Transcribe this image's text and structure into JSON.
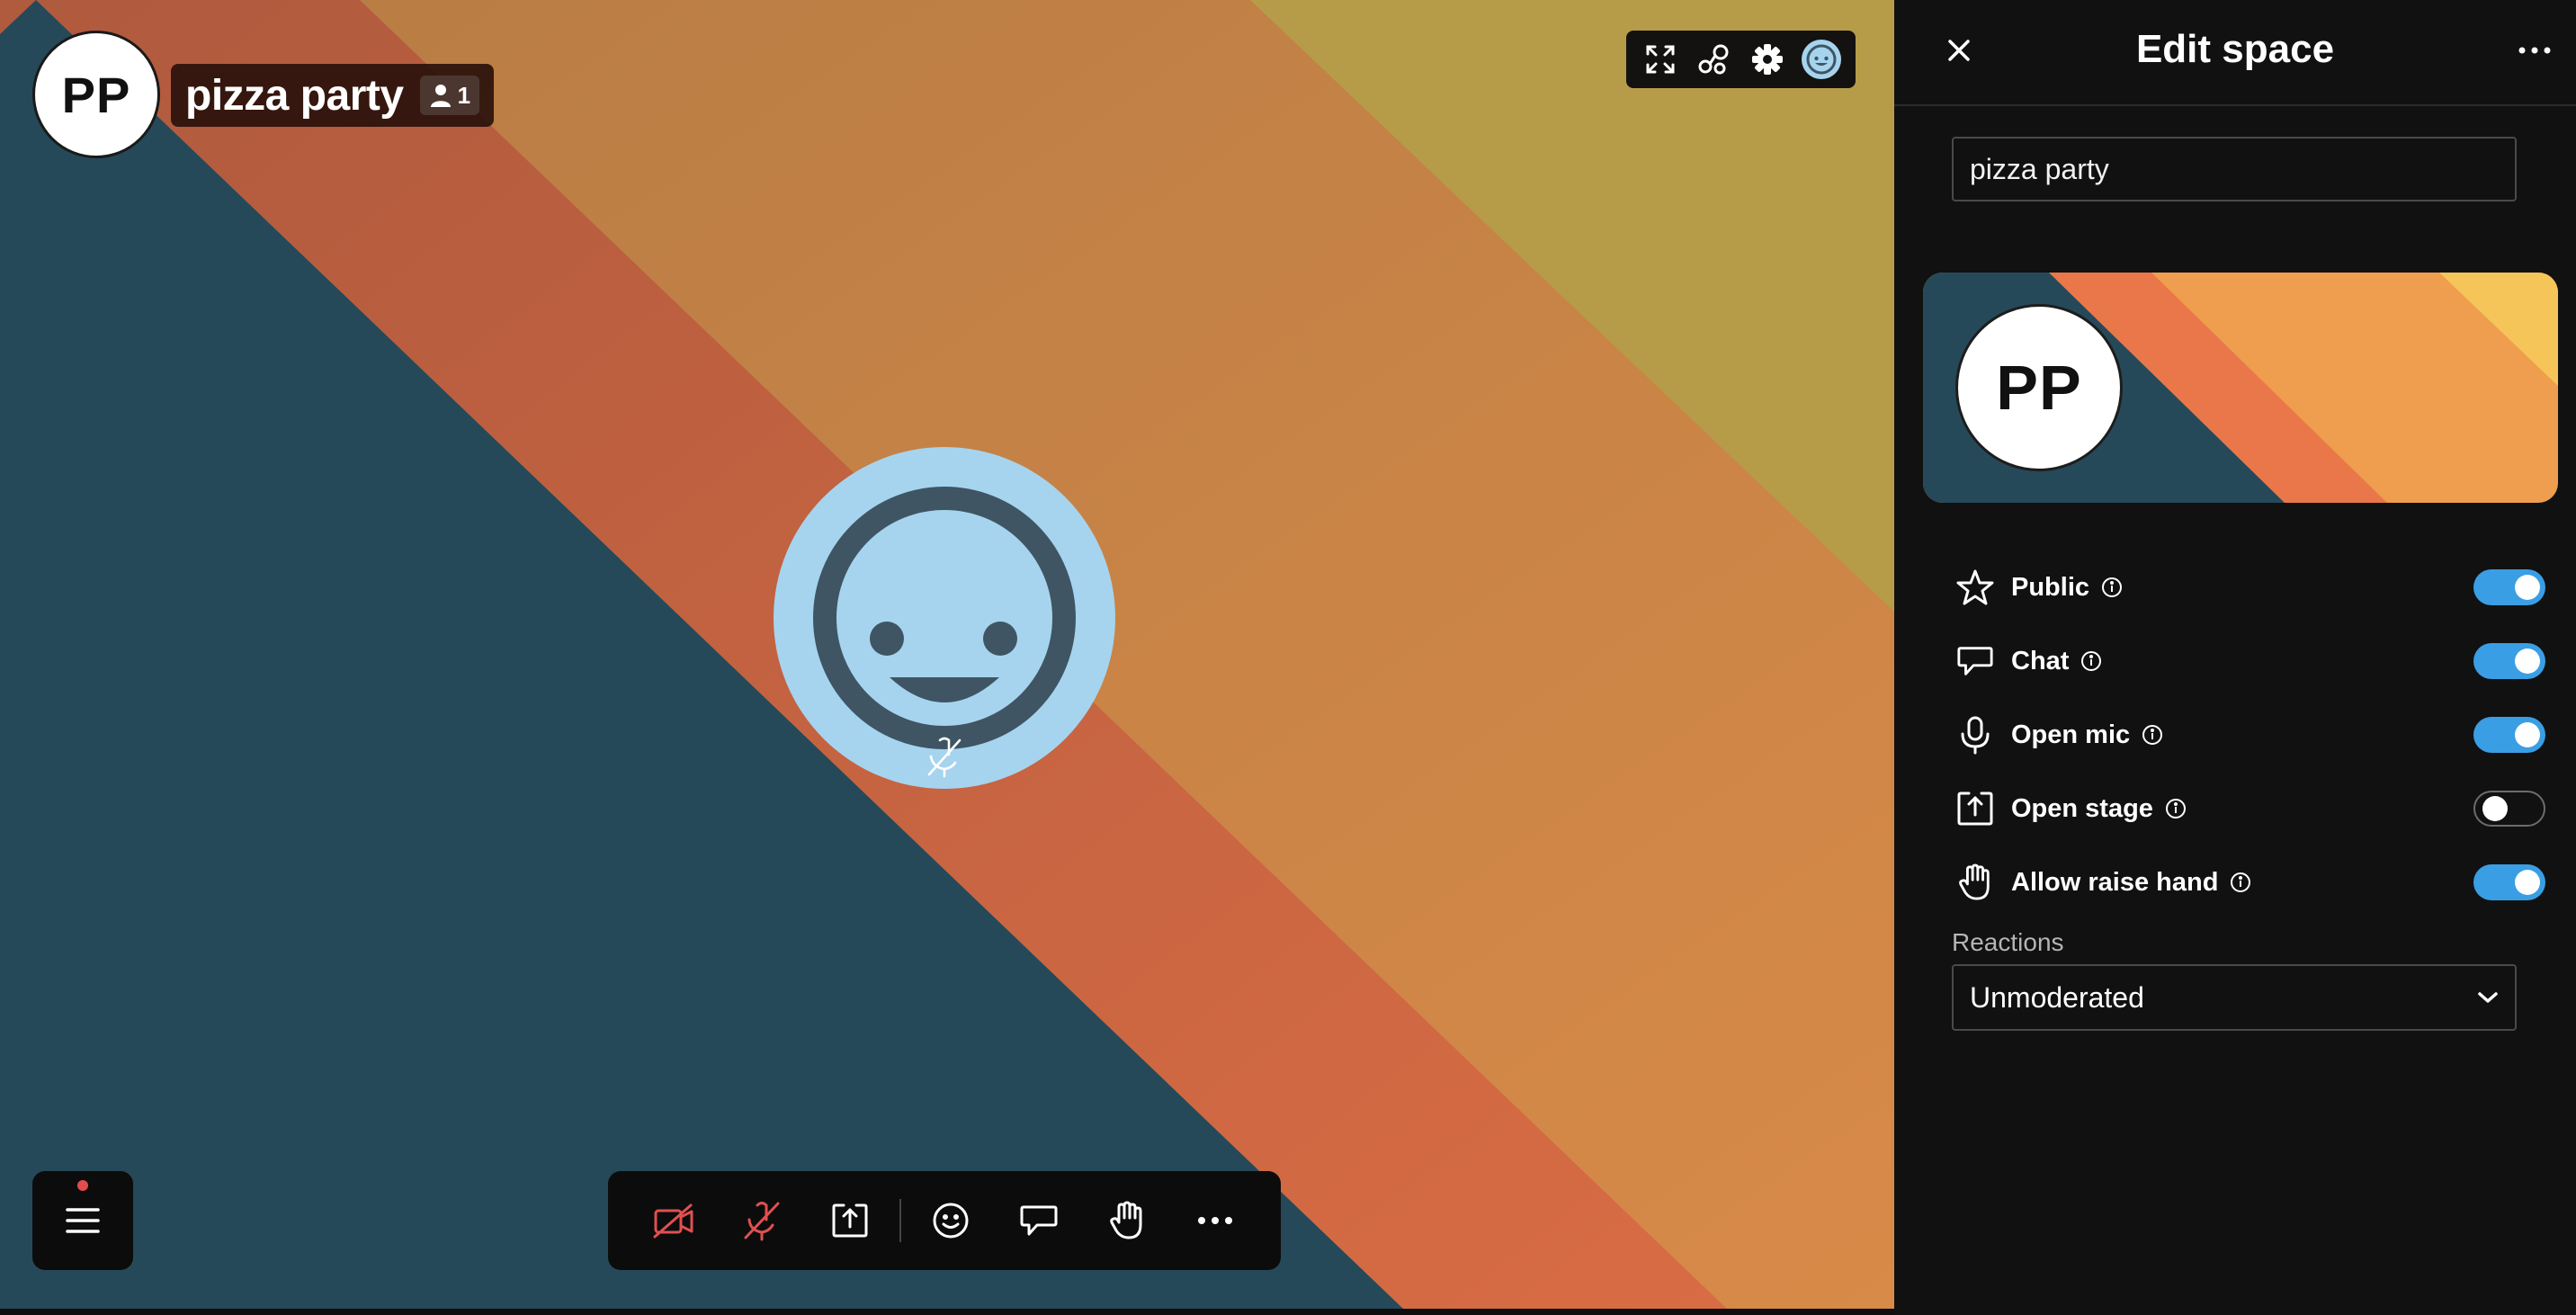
{
  "space": {
    "initials": "PP",
    "name": "pizza party",
    "participant_count": "1"
  },
  "toolbar_top": {
    "icons": [
      "fullscreen-icon",
      "share-network-icon",
      "gear-icon",
      "user-avatar-icon"
    ]
  },
  "toolbar_bottom": {
    "icons": [
      "camera-off-icon",
      "mic-off-icon",
      "share-screen-icon",
      "emoji-icon",
      "chat-icon",
      "raise-hand-icon",
      "more-icon"
    ]
  },
  "panel": {
    "title": "Edit space",
    "name_value": "pizza party",
    "banner_initials": "PP",
    "settings": [
      {
        "label": "Public",
        "icon": "star-icon",
        "enabled": true
      },
      {
        "label": "Chat",
        "icon": "chat-icon",
        "enabled": true
      },
      {
        "label": "Open mic",
        "icon": "microphone-icon",
        "enabled": true
      },
      {
        "label": "Open stage",
        "icon": "upload-stage-icon",
        "enabled": false
      },
      {
        "label": "Allow raise hand",
        "icon": "raise-hand-icon",
        "enabled": true
      }
    ],
    "reactions_label": "Reactions",
    "reactions_value": "Unmoderated"
  },
  "colors": {
    "stage_navy": "#254958",
    "stage_red": "#c86844",
    "stage_orange": "#cf8a48",
    "stage_gold": "#b69c48",
    "toggle_on": "#3a9ee4",
    "avatar_bubble": "#a6d4ee",
    "mute_red": "#e05050"
  }
}
